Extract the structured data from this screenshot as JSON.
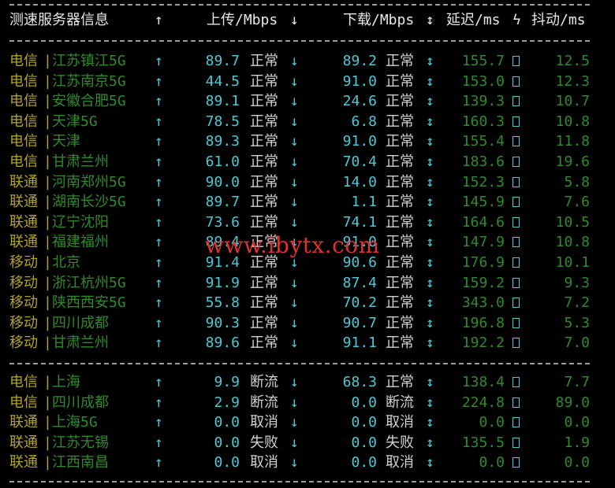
{
  "header": {
    "title": "测速服务器信息",
    "up_arrow": "↑",
    "up_label": "上传/Mbps",
    "down_arrow": "↓",
    "down_label": "下载/Mbps",
    "updown_arrow": "↕",
    "latency_label": "延迟/ms",
    "bolt": "ϟ",
    "jitter_label": "抖动/ms"
  },
  "arrows": {
    "up": "↑",
    "down": "↓",
    "both": "↕"
  },
  "separator": "|",
  "group1": [
    {
      "isp": "电信",
      "node": "江苏镇江5G",
      "up": "89.7",
      "up_status": "正常",
      "down": "89.2",
      "down_status": "正常",
      "latency": "155.7",
      "jitter": "12.5"
    },
    {
      "isp": "电信",
      "node": "江苏南京5G",
      "up": "44.5",
      "up_status": "正常",
      "down": "91.0",
      "down_status": "正常",
      "latency": "153.0",
      "jitter": "12.3"
    },
    {
      "isp": "电信",
      "node": "安徽合肥5G",
      "up": "89.1",
      "up_status": "正常",
      "down": "24.6",
      "down_status": "正常",
      "latency": "139.3",
      "jitter": "10.7"
    },
    {
      "isp": "电信",
      "node": "天津5G",
      "up": "78.5",
      "up_status": "正常",
      "down": "6.8",
      "down_status": "正常",
      "latency": "160.3",
      "jitter": "10.8"
    },
    {
      "isp": "电信",
      "node": "天津",
      "up": "89.3",
      "up_status": "正常",
      "down": "91.0",
      "down_status": "正常",
      "latency": "155.4",
      "jitter": "11.8"
    },
    {
      "isp": "电信",
      "node": "甘肃兰州",
      "up": "61.0",
      "up_status": "正常",
      "down": "70.4",
      "down_status": "正常",
      "latency": "183.6",
      "jitter": "19.6"
    },
    {
      "isp": "联通",
      "node": "河南郑州5G",
      "up": "90.0",
      "up_status": "正常",
      "down": "14.0",
      "down_status": "正常",
      "latency": "152.3",
      "jitter": "5.8"
    },
    {
      "isp": "联通",
      "node": "湖南长沙5G",
      "up": "89.7",
      "up_status": "正常",
      "down": "1.1",
      "down_status": "正常",
      "latency": "145.9",
      "jitter": "7.6"
    },
    {
      "isp": "联通",
      "node": "辽宁沈阳",
      "up": "73.6",
      "up_status": "正常",
      "down": "74.1",
      "down_status": "正常",
      "latency": "164.6",
      "jitter": "10.5"
    },
    {
      "isp": "联通",
      "node": "福建福州",
      "up": "89.4",
      "up_status": "正常",
      "down": "91.0",
      "down_status": "正常",
      "latency": "147.9",
      "jitter": "10.8"
    },
    {
      "isp": "移动",
      "node": "北京",
      "up": "91.4",
      "up_status": "正常",
      "down": "90.6",
      "down_status": "正常",
      "latency": "176.9",
      "jitter": "10.1"
    },
    {
      "isp": "移动",
      "node": "浙江杭州5G",
      "up": "91.9",
      "up_status": "正常",
      "down": "87.4",
      "down_status": "正常",
      "latency": "159.2",
      "jitter": "9.3"
    },
    {
      "isp": "移动",
      "node": "陕西西安5G",
      "up": "55.8",
      "up_status": "正常",
      "down": "70.2",
      "down_status": "正常",
      "latency": "343.0",
      "jitter": "7.2"
    },
    {
      "isp": "移动",
      "node": "四川成都",
      "up": "90.3",
      "up_status": "正常",
      "down": "90.7",
      "down_status": "正常",
      "latency": "196.8",
      "jitter": "5.3"
    },
    {
      "isp": "移动",
      "node": "甘肃兰州",
      "up": "89.6",
      "up_status": "正常",
      "down": "91.1",
      "down_status": "正常",
      "latency": "192.2",
      "jitter": "7.0"
    }
  ],
  "group2": [
    {
      "isp": "电信",
      "node": "上海",
      "up": "9.9",
      "up_status": "断流",
      "down": "68.3",
      "down_status": "正常",
      "latency": "138.4",
      "jitter": "7.7"
    },
    {
      "isp": "电信",
      "node": "四川成都",
      "up": "2.9",
      "up_status": "断流",
      "down": "0.0",
      "down_status": "断流",
      "latency": "224.8",
      "jitter": "89.0"
    },
    {
      "isp": "联通",
      "node": "上海5G",
      "up": "0.0",
      "up_status": "取消",
      "down": "0.0",
      "down_status": "取消",
      "latency": "0.0",
      "jitter": "0.0"
    },
    {
      "isp": "联通",
      "node": "江苏无锡",
      "up": "0.0",
      "up_status": "失败",
      "down": "0.0",
      "down_status": "失败",
      "latency": "135.5",
      "jitter": "1.9"
    },
    {
      "isp": "联通",
      "node": "江西南昌",
      "up": "0.0",
      "up_status": "取消",
      "down": "0.0",
      "down_status": "取消",
      "latency": "0.0",
      "jitter": "0.0"
    }
  ],
  "watermark": "www.ibytx.com",
  "colors": {
    "isp": "#b2a22a",
    "node": "#2f8a2a",
    "value": "#4dc9d6",
    "status": "#d0d0d0",
    "watermark": "#e0302f"
  }
}
